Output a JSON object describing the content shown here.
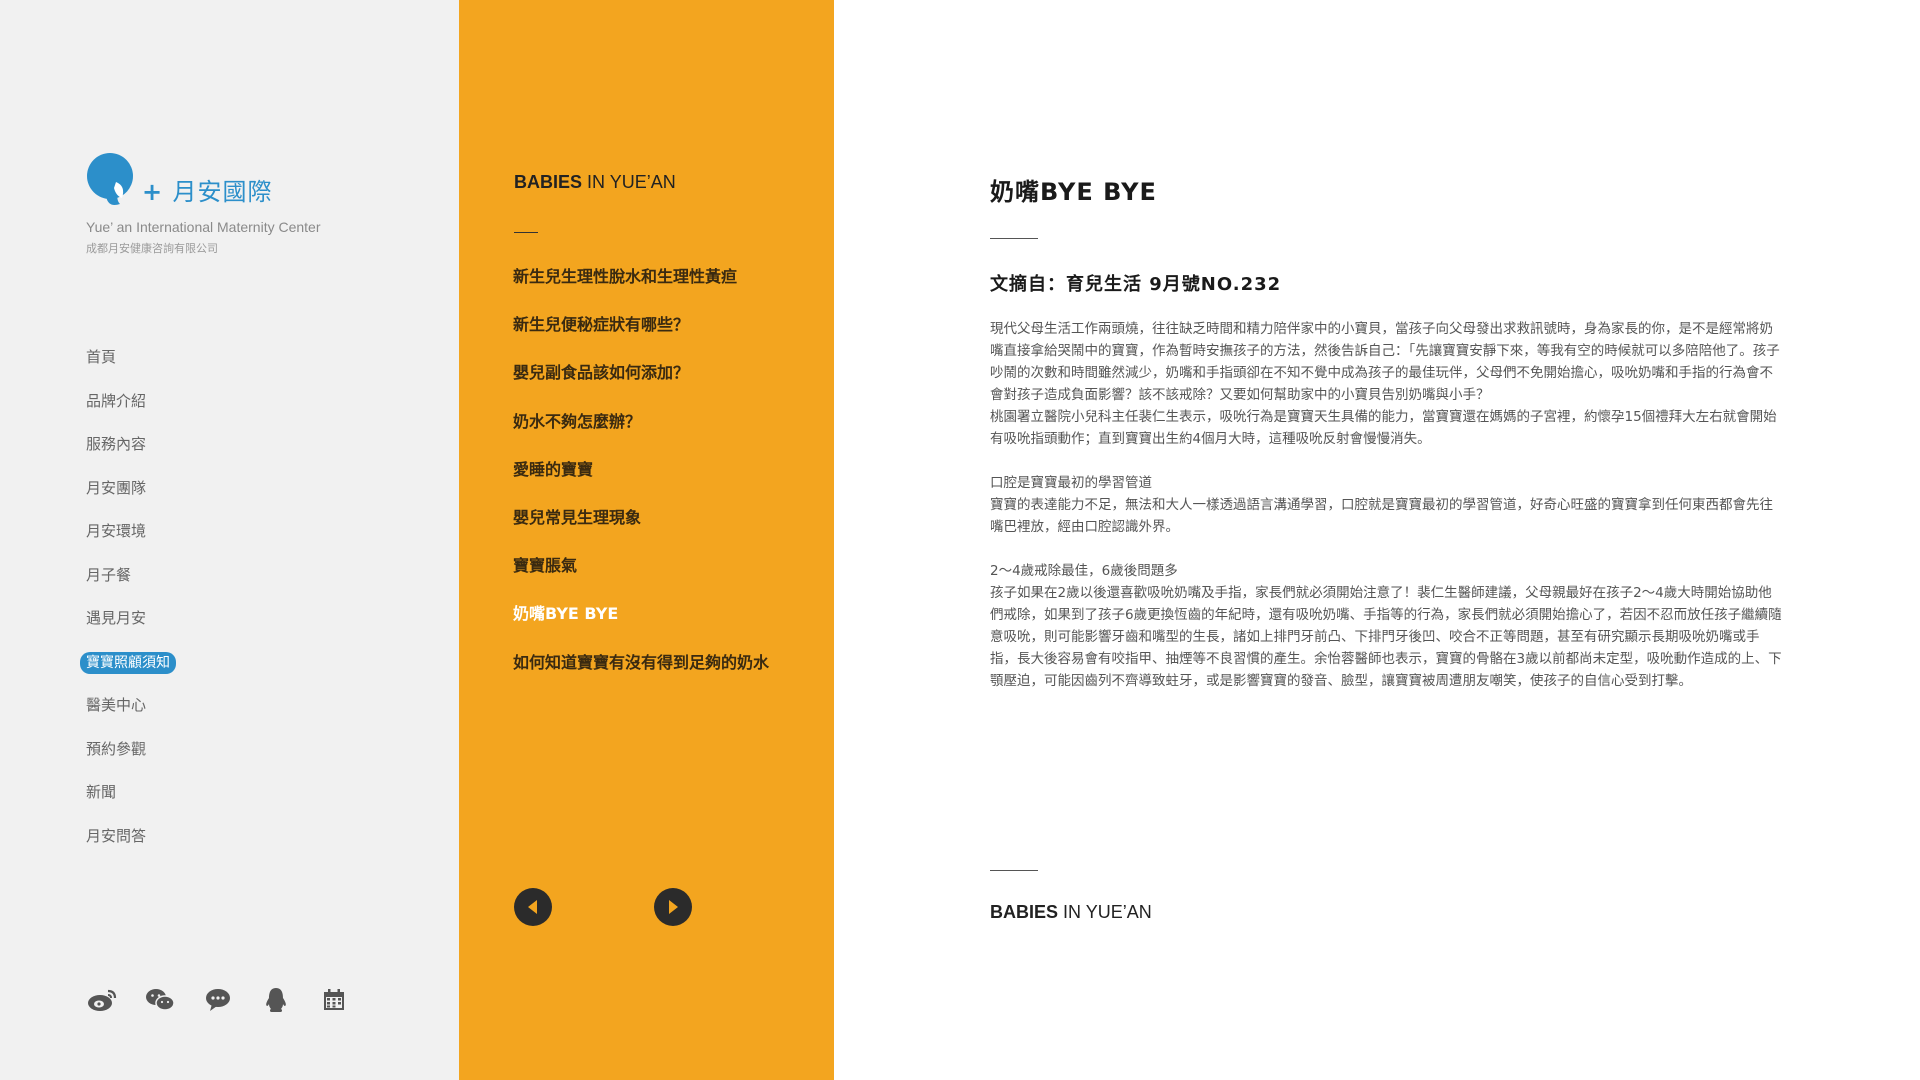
{
  "brand": {
    "name_cn": "月安國際",
    "name_en": "Yue’ an International  Maternity Center",
    "company": "成都月安健康咨詢有限公司",
    "color": "#2c8fca"
  },
  "sidebar": {
    "items": [
      {
        "label": "首頁"
      },
      {
        "label": "品牌介紹"
      },
      {
        "label": "服務內容"
      },
      {
        "label": "月安團隊"
      },
      {
        "label": "月安環境"
      },
      {
        "label": "月子餐"
      },
      {
        "label": "遇見月安"
      },
      {
        "label": "寶寶照顧須知",
        "active": true
      },
      {
        "label": "醫美中心"
      },
      {
        "label": "預約參觀"
      },
      {
        "label": "新聞"
      },
      {
        "label": "月安問答"
      }
    ],
    "social_icons": [
      "weibo-icon",
      "wechat-icon",
      "chat-icon",
      "qq-icon",
      "calendar-icon"
    ]
  },
  "middle": {
    "title_bold": "BABIES",
    "title_rest": " IN YUE’AN",
    "background": "#f3a51f",
    "articles": [
      {
        "label": "新生兒生理性脫水和生理性黃疸"
      },
      {
        "label": "新生兒便秘症狀有哪些？"
      },
      {
        "label": "嬰兒副食品該如何添加？"
      },
      {
        "label": "奶水不夠怎麼辦？"
      },
      {
        "label": "愛睡的寶寶"
      },
      {
        "label": "嬰兒常見生理現象"
      },
      {
        "label": "寶寶脹氣"
      },
      {
        "label": "奶嘴BYE BYE",
        "active": true
      },
      {
        "label": "如何知道寶寶有沒有得到足夠的奶水"
      }
    ]
  },
  "content": {
    "title": "奶嘴BYE BYE",
    "source": "文摘自：育兒生活 9月號NO.232",
    "paragraphs": [
      {
        "text": "現代父母生活工作兩頭燒，往往缺乏時間和精力陪伴家中的小寶貝，當孩子向父母發出求救訊號時，身為家長的你，是不是經常將奶嘴直接拿給哭鬧中的寶寶，作為暫時安撫孩子的方法，然後告訴自己：「先讓寶寶安靜下來，等我有空的時候就可以多陪陪他了。孩子吵鬧的次數和時間雖然減少，奶嘴和手指頭卻在不知不覺中成為孩子的最佳玩伴，父母們不免開始擔心，吸吮奶嘴和手指的行為會不會對孩子造成負面影響？該不該戒除？又要如何幫助家中的小寶貝告別奶嘴與小手？"
      },
      {
        "text": "桃園署立醫院小兒科主任裴仁生表示，吸吮行為是寶寶天生具備的能力，當寶寶還在媽媽的子宮裡，約懷孕15個禮拜大左右就會開始有吸吮指頭動作；直到寶寶出生約4個月大時，這種吸吮反射會慢慢消失。"
      },
      {
        "text": "口腔是寶寶最初的學習管道",
        "gap": true
      },
      {
        "text": "寶寶的表達能力不足，無法和大人一樣透過語言溝通學習，口腔就是寶寶最初的學習管道，好奇心旺盛的寶寶拿到任何東西都會先往嘴巴裡放，經由口腔認識外界。"
      },
      {
        "text": "2～4歲戒除最佳，6歲後問題多",
        "gap": true
      },
      {
        "text": "孩子如果在2歲以後還喜歡吸吮奶嘴及手指，家長們就必須開始注意了！裴仁生醫師建議，父母親最好在孩子2～4歲大時開始協助他們戒除，如果到了孩子6歲更換恆齒的年紀時，還有吸吮奶嘴、手指等的行為，家長們就必須開始擔心了，若因不忍而放任孩子繼續隨意吸吮，則可能影響牙齒和嘴型的生長，諸如上排門牙前凸、下排門牙後凹、咬合不正等問題，甚至有研究顯示長期吸吮奶嘴或手指，長大後容易會有咬指甲、抽煙等不良習慣的產生。余怡蓉醫師也表示，寶寶的骨骼在3歲以前都尚未定型，吸吮動作造成的上、下顎壓迫，可能因齒列不齊導致蛀牙，或是影響寶寶的發音、臉型，讓寶寶被周遭朋友嘲笑，使孩子的自信心受到打擊。"
      }
    ],
    "footer_bold": "BABIES",
    "footer_rest": " IN YUE’AN"
  }
}
